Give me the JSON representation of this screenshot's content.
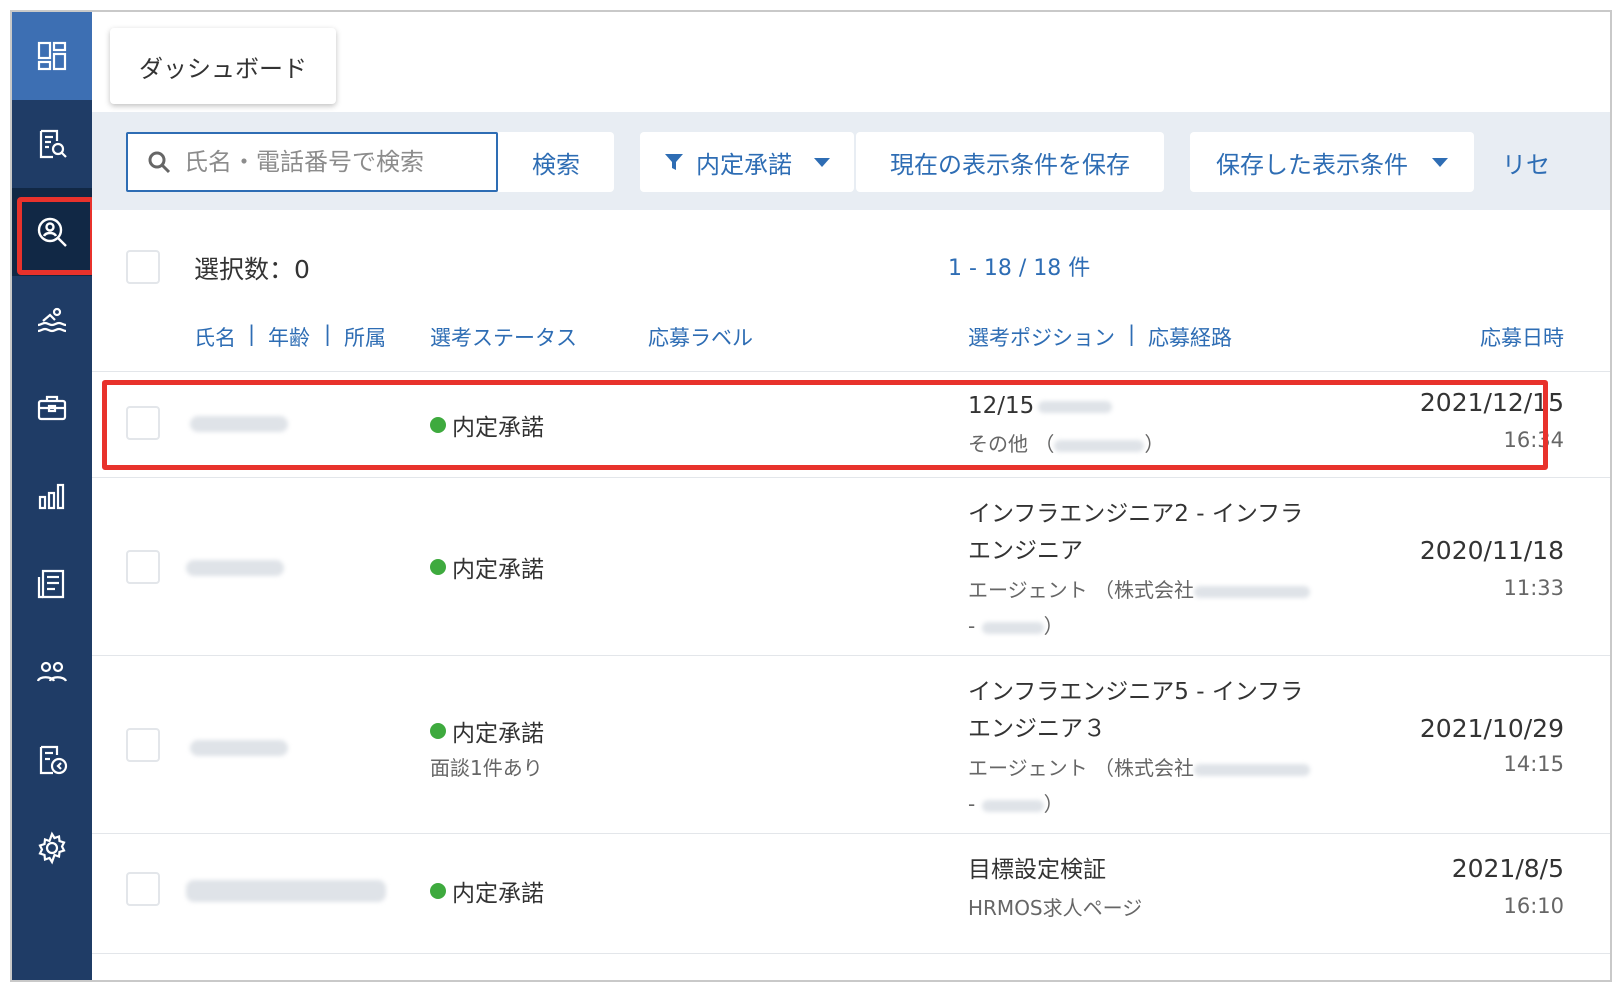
{
  "sidebar": {
    "items": [
      {
        "icon": "dashboard-icon"
      },
      {
        "icon": "document-search-icon"
      },
      {
        "icon": "user-search-icon"
      },
      {
        "icon": "swimmer-icon"
      },
      {
        "icon": "briefcase-icon"
      },
      {
        "icon": "bar-chart-icon"
      },
      {
        "icon": "report-icon"
      },
      {
        "icon": "people-icon"
      },
      {
        "icon": "export-document-icon"
      },
      {
        "icon": "gear-icon"
      }
    ],
    "active_index": 2
  },
  "tabs": {
    "dashboard_label": "ダッシュボード"
  },
  "toolbar": {
    "search_placeholder": "氏名・電話番号で検索",
    "search_button": "検索",
    "filter_label": "内定承諾",
    "save_condition_button": "現在の表示条件を保存",
    "saved_conditions_label": "保存した表示条件",
    "reset_label": "リセ"
  },
  "list": {
    "select_count_label": "選択数：0",
    "pagination": "1 - 18 / 18 件",
    "columns": {
      "name": "氏名",
      "age": "年齢",
      "affiliation": "所属",
      "separator": "|",
      "status": "選考ステータス",
      "label": "応募ラベル",
      "position": "選考ポジション",
      "route": "応募経路",
      "date": "応募日時"
    },
    "rows": [
      {
        "status": "内定承諾",
        "note": "",
        "position_lines": [
          "12/15"
        ],
        "route_lines": [
          "その他 （"
        ],
        "route_suffix": "）",
        "date": "2021/12/15",
        "time": "16:34"
      },
      {
        "status": "内定承諾",
        "note": "",
        "position_lines": [
          "インフラエンジニア2 - インフラ",
          "エンジニア"
        ],
        "route_lines": [
          "エージェント （株式会社",
          "- "
        ],
        "route_suffix": "）",
        "date": "2020/11/18",
        "time": "11:33"
      },
      {
        "status": "内定承諾",
        "note": "面談1件あり",
        "position_lines": [
          "インフラエンジニア5 - インフラ",
          "エンジニア３"
        ],
        "route_lines": [
          "エージェント （株式会社",
          "- "
        ],
        "route_suffix": "）",
        "date": "2021/10/29",
        "time": "14:15"
      },
      {
        "status": "内定承諾",
        "note": "",
        "position_lines": [
          "目標設定検証"
        ],
        "route_lines": [
          "HRMOS求人ページ"
        ],
        "route_suffix": "",
        "date": "2021/8/5",
        "time": "16:10"
      }
    ]
  },
  "colors": {
    "sidebar_bg": "#1f3c66",
    "sidebar_top": "#3d6fb3",
    "sidebar_active": "#112845",
    "accent": "#2e6db4",
    "status_green": "#3eaa3e",
    "highlight_red": "#e8322c",
    "toolbar_bg": "#e8edf3"
  }
}
